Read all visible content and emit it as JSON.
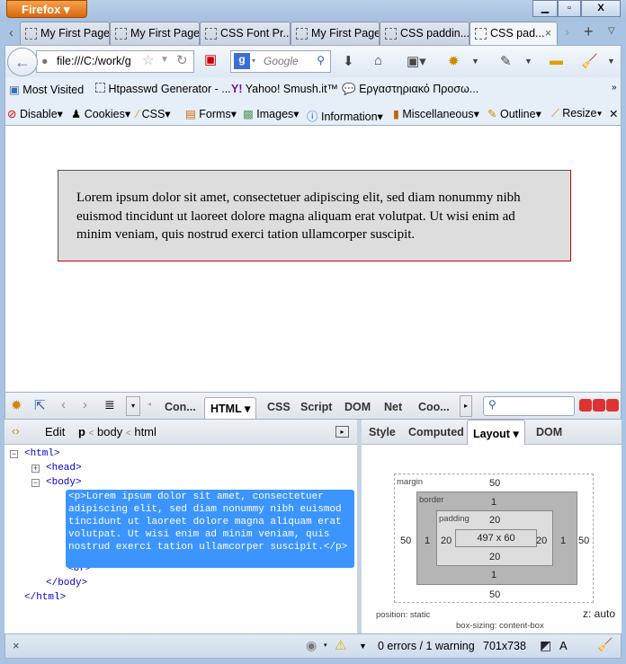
{
  "window": {
    "app_button": "Firefox",
    "controls": [
      "minimize",
      "maximize",
      "close"
    ]
  },
  "tabs": [
    {
      "label": "My First Page"
    },
    {
      "label": "My First Page"
    },
    {
      "label": "CSS Font Pr..."
    },
    {
      "label": "My First Page"
    },
    {
      "label": "CSS paddin..."
    },
    {
      "label": "CSS pad...",
      "active": true
    }
  ],
  "navbar": {
    "url": "file:///C:/work/g",
    "search_placeholder": "Google"
  },
  "bookmarks": [
    "Most Visited",
    "Htpasswd Generator - ...",
    "Yahoo! Smush.it™",
    "Εργαστηριακό Προσω..."
  ],
  "webdev_toolbar": [
    "Disable",
    "Cookies",
    "CSS",
    "Forms",
    "Images",
    "Information",
    "Miscellaneous",
    "Outline",
    "Resize"
  ],
  "page": {
    "paragraph": "Lorem ipsum dolor sit amet, consectetuer adipiscing elit, sed diam nonummy nibh euismod tincidunt ut laoreet dolore magna aliquam erat volutpat. Ut wisi enim ad minim veniam, quis nostrud exerci tation ullamcorper suscipit."
  },
  "firebug": {
    "tabs": [
      "Con...",
      "HTML",
      "CSS",
      "Script",
      "DOM",
      "Net",
      "Coo..."
    ],
    "active_tab": "HTML",
    "edit": "Edit",
    "breadcrumb": [
      "p",
      "body",
      "html"
    ],
    "breadcrumb_sep": "<",
    "side_tabs": [
      "Style",
      "Computed",
      "Layout",
      "DOM"
    ],
    "active_side_tab": "Layout",
    "tree": {
      "html_open": "<html>",
      "head": "<head>",
      "body_open": "<body>",
      "p": "<p>Lorem ipsum dolor sit amet, consectetuer adipiscing elit, sed diam nonummy nibh euismod tincidunt ut laoreet dolore magna aliquam erat volutpat. Ut wisi enim ad minim veniam, quis nostrud exerci tation ullamcorper suscipit.</p>",
      "br": "<br>",
      "body_close": "</body>",
      "html_close": "</html>"
    },
    "layout": {
      "margin_label": "margin",
      "border_label": "border",
      "padding_label": "padding",
      "margin": "50",
      "border": "1",
      "padding": "20",
      "content": "497 x 60",
      "position": "position: static",
      "z": "z: auto",
      "box_sizing": "box-sizing: content-box"
    },
    "status": {
      "close": "×",
      "errors": "0 errors / 1 warning",
      "size": "701x738",
      "a": "A"
    }
  },
  "colors": {
    "selection": "#3c95ff",
    "firefox_button": "#e07a1f",
    "box_bg": "#dddddd",
    "box_border_accent": "#cc0000"
  }
}
